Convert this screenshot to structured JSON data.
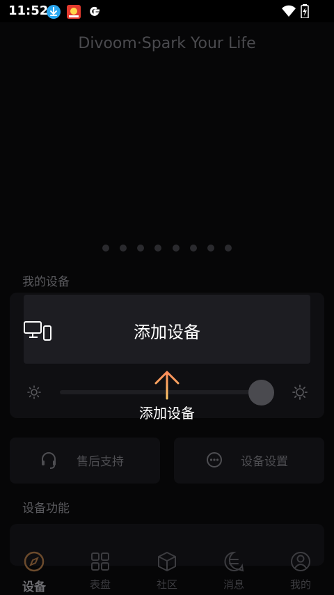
{
  "status_bar": {
    "time": "11:52",
    "icons": [
      "download-icon",
      "app-notification-icon",
      "google-icon",
      "wifi-icon",
      "battery-charging-icon"
    ]
  },
  "header": {
    "tagline": "Divoom·Spark Your Life"
  },
  "carousel": {
    "page_count": 8
  },
  "my_devices": {
    "section_title": "我的设备",
    "add_device_label": "添加设备",
    "brightness_level": 0.9
  },
  "quick_actions": {
    "after_sales_label": "售后支持",
    "device_settings_label": "设备设置"
  },
  "device_features": {
    "section_title": "设备功能"
  },
  "guide": {
    "hint_label": "添加设备"
  },
  "bottom_nav": {
    "items": [
      {
        "label": "设备",
        "icon": "compass-icon",
        "active": true
      },
      {
        "label": "表盘",
        "icon": "grid-icon",
        "active": false
      },
      {
        "label": "社区",
        "icon": "cube-icon",
        "active": false
      },
      {
        "label": "消息",
        "icon": "message-icon",
        "active": false
      },
      {
        "label": "我的",
        "icon": "profile-icon",
        "active": false
      }
    ]
  },
  "colors": {
    "guide_arrow_start": "#ff8c5a",
    "guide_arrow_end": "#ffc76a",
    "highlight_bg": "#1d1d22"
  }
}
